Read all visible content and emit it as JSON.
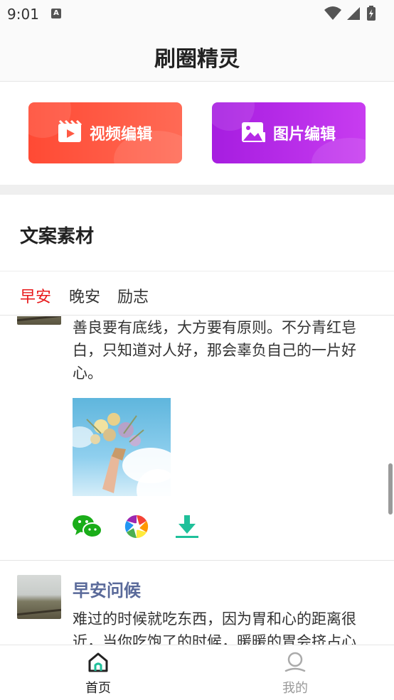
{
  "status_bar": {
    "time": "9:01",
    "notification_icon": "a-icon"
  },
  "app": {
    "title": "刷圈精灵"
  },
  "tools": [
    {
      "label": "视频编辑",
      "icon": "video-icon",
      "color": "#ff4a34"
    },
    {
      "label": "图片编辑",
      "icon": "image-icon",
      "color": "#b026e8"
    }
  ],
  "section": {
    "title": "文案素材"
  },
  "tabs": [
    {
      "label": "早安",
      "active": true
    },
    {
      "label": "晚安",
      "active": false
    },
    {
      "label": "励志",
      "active": false
    }
  ],
  "posts": [
    {
      "text": "善良要有底线，大方要有原则。不分青红皂白，只知道对人好，那会辜负自己的一片好心。",
      "image": "flower-bouquet-photo",
      "actions": [
        "wechat-icon",
        "moments-icon",
        "download-icon"
      ]
    },
    {
      "title": "早安问候",
      "text": "难过的时候就吃东西，因为胃和心的距离很近，当你吃饱了的时候，暖暖的胃会挤占心"
    }
  ],
  "bottom_nav": [
    {
      "label": "首页",
      "icon": "home-icon",
      "active": true
    },
    {
      "label": "我的",
      "icon": "profile-icon",
      "active": false
    }
  ],
  "colors": {
    "accent_red": "#e8191b",
    "title_blue": "#5a6a9a",
    "wechat_green": "#1aad19",
    "download_teal": "#1fc09a"
  }
}
